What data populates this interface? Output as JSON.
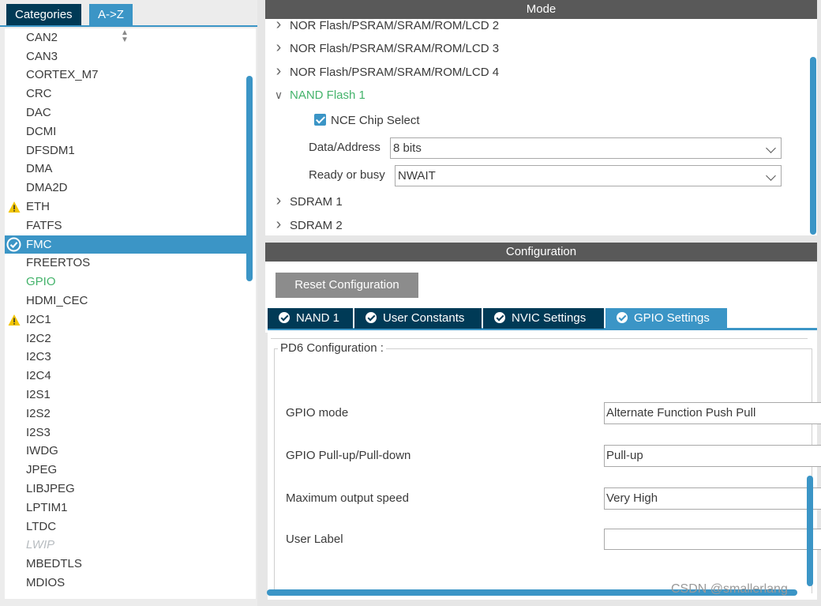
{
  "categories_tabs": {
    "categories": "Categories",
    "az": "A->Z"
  },
  "peripherals": [
    {
      "label": "CAN2",
      "state": "normal"
    },
    {
      "label": "CAN3",
      "state": "normal"
    },
    {
      "label": "CORTEX_M7",
      "state": "normal"
    },
    {
      "label": "CRC",
      "state": "normal"
    },
    {
      "label": "DAC",
      "state": "normal"
    },
    {
      "label": "DCMI",
      "state": "normal"
    },
    {
      "label": "DFSDM1",
      "state": "normal"
    },
    {
      "label": "DMA",
      "state": "normal"
    },
    {
      "label": "DMA2D",
      "state": "normal"
    },
    {
      "label": "ETH",
      "state": "warning"
    },
    {
      "label": "FATFS",
      "state": "normal"
    },
    {
      "label": "FMC",
      "state": "selected"
    },
    {
      "label": "FREERTOS",
      "state": "normal"
    },
    {
      "label": "GPIO",
      "state": "green"
    },
    {
      "label": "HDMI_CEC",
      "state": "normal"
    },
    {
      "label": "I2C1",
      "state": "warning"
    },
    {
      "label": "I2C2",
      "state": "normal"
    },
    {
      "label": "I2C3",
      "state": "normal"
    },
    {
      "label": "I2C4",
      "state": "normal"
    },
    {
      "label": "I2S1",
      "state": "normal"
    },
    {
      "label": "I2S2",
      "state": "normal"
    },
    {
      "label": "I2S3",
      "state": "normal"
    },
    {
      "label": "IWDG",
      "state": "normal"
    },
    {
      "label": "JPEG",
      "state": "normal"
    },
    {
      "label": "LIBJPEG",
      "state": "normal"
    },
    {
      "label": "LPTIM1",
      "state": "normal"
    },
    {
      "label": "LTDC",
      "state": "normal"
    },
    {
      "label": "LWIP",
      "state": "disabled"
    },
    {
      "label": "MBEDTLS",
      "state": "normal"
    },
    {
      "label": "MDIOS",
      "state": "normal"
    }
  ],
  "mode": {
    "header": "Mode",
    "tree": [
      {
        "label": "NOR Flash/PSRAM/SRAM/ROM/LCD 2",
        "expanded": false
      },
      {
        "label": "NOR Flash/PSRAM/SRAM/ROM/LCD 3",
        "expanded": false
      },
      {
        "label": "NOR Flash/PSRAM/SRAM/ROM/LCD 4",
        "expanded": false
      },
      {
        "label": "NAND Flash 1",
        "expanded": true
      },
      {
        "label": "SDRAM 1",
        "expanded": false
      },
      {
        "label": "SDRAM 2",
        "expanded": false
      }
    ],
    "nce_chip_select": {
      "label": "NCE Chip Select",
      "checked": true
    },
    "data_address": {
      "label": "Data/Address",
      "value": "8 bits"
    },
    "ready_or_busy": {
      "label": "Ready or busy",
      "value": "NWAIT"
    }
  },
  "configuration": {
    "header": "Configuration",
    "reset_button": "Reset Configuration",
    "tabs": [
      {
        "label": "NAND 1",
        "active": false
      },
      {
        "label": "User Constants",
        "active": false
      },
      {
        "label": "NVIC Settings",
        "active": false
      },
      {
        "label": "GPIO Settings",
        "active": true
      }
    ],
    "pd6": {
      "legend": "PD6 Configuration :",
      "gpio_mode": {
        "label": "GPIO mode",
        "value": "Alternate Function Push Pull"
      },
      "pull": {
        "label": "GPIO Pull-up/Pull-down",
        "value": "Pull-up"
      },
      "speed": {
        "label": "Maximum output speed",
        "value": "Very High"
      },
      "user_label": {
        "label": "User Label",
        "value": ""
      }
    }
  },
  "watermark": "CSDN @smallerlang",
  "colors": {
    "accent": "#3b95c6",
    "dark_tab": "#003a56",
    "header": "#595959",
    "green": "#44b36b",
    "warning": "#f2c500"
  }
}
